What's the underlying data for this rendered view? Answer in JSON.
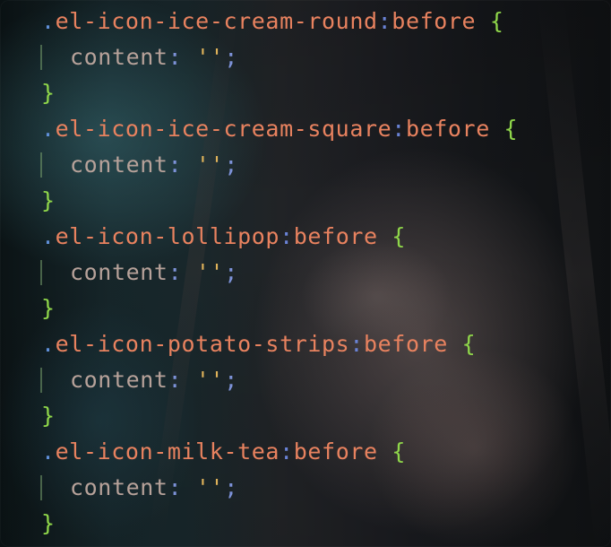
{
  "editor": {
    "rules": [
      {
        "dot": ".",
        "selector": "el-icon-ice-cream-round",
        "colon": ":",
        "pseudo": "before",
        "open": "{",
        "property": "content",
        "prop_colon": ":",
        "quote_open": "'",
        "value": "",
        "quote_close": "'",
        "semicolon": ";",
        "close": "}"
      },
      {
        "dot": ".",
        "selector": "el-icon-ice-cream-square",
        "colon": ":",
        "pseudo": "before",
        "open": "{",
        "property": "content",
        "prop_colon": ":",
        "quote_open": "'",
        "value": "",
        "quote_close": "'",
        "semicolon": ";",
        "close": "}"
      },
      {
        "dot": ".",
        "selector": "el-icon-lollipop",
        "colon": ":",
        "pseudo": "before",
        "open": "{",
        "property": "content",
        "prop_colon": ":",
        "quote_open": "'",
        "value": "",
        "quote_close": "'",
        "semicolon": ";",
        "close": "}"
      },
      {
        "dot": ".",
        "selector": "el-icon-potato-strips",
        "colon": ":",
        "pseudo": "before",
        "open": "{",
        "property": "content",
        "prop_colon": ":",
        "quote_open": "'",
        "value": "",
        "quote_close": "'",
        "semicolon": ";",
        "close": "}"
      },
      {
        "dot": ".",
        "selector": "el-icon-milk-tea",
        "colon": ":",
        "pseudo": "before",
        "open": "{",
        "property": "content",
        "prop_colon": ":",
        "quote_open": "'",
        "value": "",
        "quote_close": "'",
        "semicolon": ";",
        "close": "}"
      }
    ]
  },
  "colors": {
    "selector": "#e8825f",
    "punctuation": "#6a83d6",
    "brace": "#8fd64a",
    "property": "#b7a29a",
    "string": "#e0b35a"
  }
}
